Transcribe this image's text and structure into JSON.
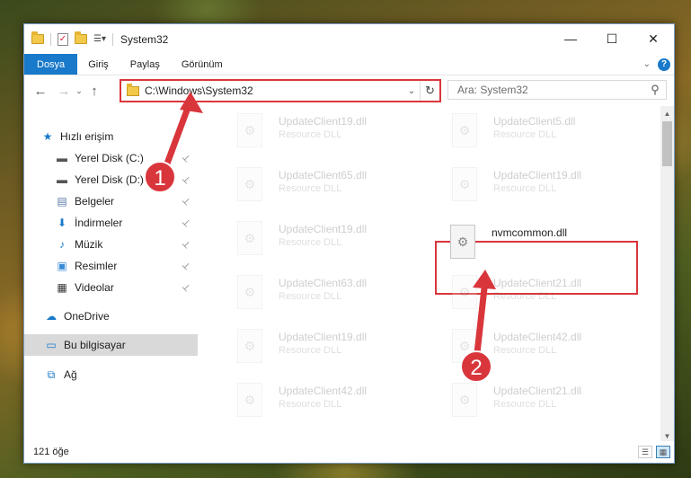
{
  "window": {
    "title": "System32",
    "controls": {
      "minimize": "—",
      "maximize": "☐",
      "close": "✕"
    }
  },
  "ribbon": {
    "tabs": [
      "Dosya",
      "Giriş",
      "Paylaş",
      "Görünüm"
    ],
    "active_tab": "Dosya",
    "collapse_glyph": "⌄",
    "help_glyph": "?"
  },
  "navigation": {
    "back_glyph": "←",
    "forward_glyph": "→",
    "recent_glyph": "⌄",
    "up_glyph": "↑",
    "address": "C:\\Windows\\System32",
    "address_dropdown_glyph": "⌄",
    "refresh_glyph": "↻",
    "search_placeholder": "Ara: System32",
    "search_glyph": "⚲"
  },
  "sidebar": {
    "items": [
      {
        "label": "Hızlı erişim",
        "icon": "star-icon",
        "glyph": "★",
        "color": "#1979ca",
        "pinned": false
      },
      {
        "label": "Yerel Disk (C:)",
        "icon": "drive-icon",
        "glyph": "▬",
        "color": "#555555",
        "pinned": true
      },
      {
        "label": "Yerel Disk (D:)",
        "icon": "drive-icon",
        "glyph": "▬",
        "color": "#555555",
        "pinned": true
      },
      {
        "label": "Belgeler",
        "icon": "documents-icon",
        "glyph": "▤",
        "color": "#5a7ba8",
        "pinned": true
      },
      {
        "label": "İndirmeler",
        "icon": "download-icon",
        "glyph": "⬇",
        "color": "#1979ca",
        "pinned": true
      },
      {
        "label": "Müzik",
        "icon": "music-icon",
        "glyph": "♪",
        "color": "#1979ca",
        "pinned": true
      },
      {
        "label": "Resimler",
        "icon": "pictures-icon",
        "glyph": "▣",
        "color": "#3a8ad6",
        "pinned": true
      },
      {
        "label": "Videolar",
        "icon": "videos-icon",
        "glyph": "▦",
        "color": "#333333",
        "pinned": true
      },
      {
        "label": "OneDrive",
        "icon": "cloud-icon",
        "glyph": "☁",
        "color": "#1979ca",
        "pinned": false
      },
      {
        "label": "Bu bilgisayar",
        "icon": "computer-icon",
        "glyph": "▭",
        "color": "#1979ca",
        "pinned": false,
        "selected": true
      },
      {
        "label": "Ağ",
        "icon": "network-icon",
        "glyph": "⧉",
        "color": "#1979ca",
        "pinned": false
      }
    ],
    "pin_glyph": "📌"
  },
  "files": [
    {
      "name": "UpdateClient19.dll",
      "type": "Resource DLL",
      "faded": true
    },
    {
      "name": "UpdateClient5.dll",
      "type": "Resource DLL",
      "faded": true
    },
    {
      "name": "UpdateClient65.dll",
      "type": "Resource DLL",
      "faded": true
    },
    {
      "name": "UpdateClient19.dll",
      "type": "Resource DLL",
      "faded": true
    },
    {
      "name": "UpdateClient19.dll",
      "type": "Resource DLL",
      "faded": true
    },
    {
      "name": "nvmcommon.dll",
      "type": "",
      "faded": false
    },
    {
      "name": "UpdateClient63.dll",
      "type": "Resource DLL",
      "faded": true
    },
    {
      "name": "UpdateClient21.dll",
      "type": "Resource DLL",
      "faded": true
    },
    {
      "name": "UpdateClient19.dll",
      "type": "Resource DLL",
      "faded": true
    },
    {
      "name": "UpdateClient42.dll",
      "type": "Resource DLL",
      "faded": true
    },
    {
      "name": "UpdateClient42.dll",
      "type": "Resource DLL",
      "faded": true
    },
    {
      "name": "UpdateClient21.dll",
      "type": "Resource DLL",
      "faded": true
    }
  ],
  "status": {
    "item_count": "121 öğe"
  },
  "annotations": {
    "step1": "1",
    "step2": "2",
    "color": "#d9363c"
  }
}
